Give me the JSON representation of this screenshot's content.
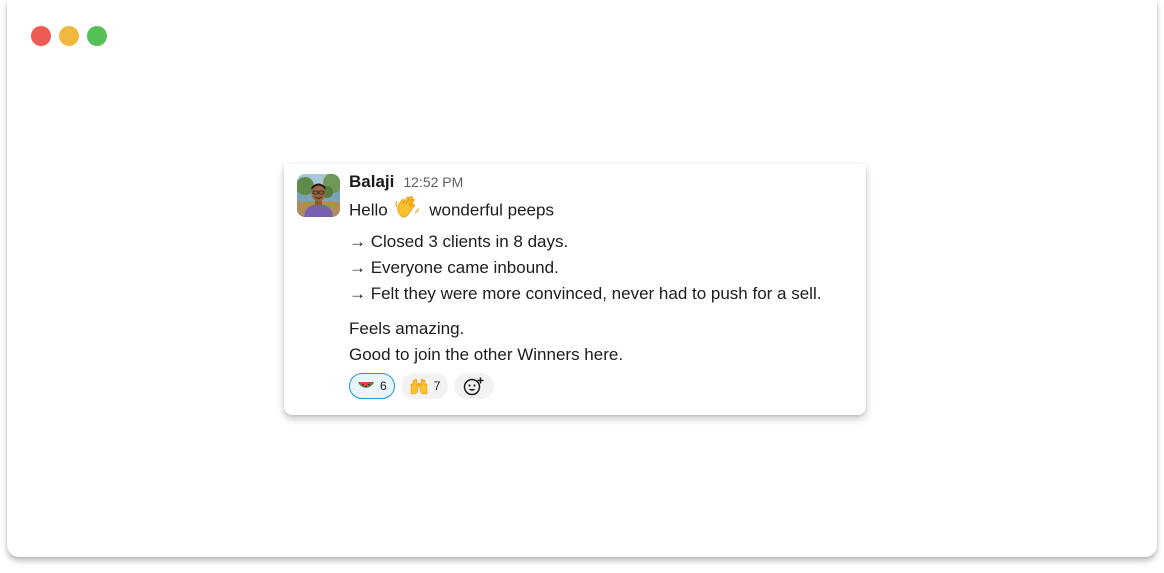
{
  "window": {
    "buttons": [
      "close",
      "minimize",
      "maximize"
    ],
    "colors": {
      "close": "#ee5b55",
      "minimize": "#f2b73e",
      "maximize": "#55c053"
    }
  },
  "message": {
    "author": "Balaji",
    "timestamp": "12:52 PM",
    "greeting_prefix": "Hello",
    "greeting_emoji": "waving-hand",
    "greeting_suffix": "wonderful peeps",
    "bullets": [
      "→ Closed 3 clients in 8 days.",
      "→ Everyone came inbound.",
      "→ Felt they were more convinced, never had to push for a sell."
    ],
    "closing": [
      "Feels amazing.",
      "Good to join the other Winners here."
    ]
  },
  "reactions": [
    {
      "emoji": "watermelon",
      "count": "6",
      "active": true
    },
    {
      "emoji": "raised-hands",
      "count": "7",
      "active": false
    }
  ],
  "add_reaction_icon": "add-emoji-icon",
  "accent": "#1d9bd1"
}
